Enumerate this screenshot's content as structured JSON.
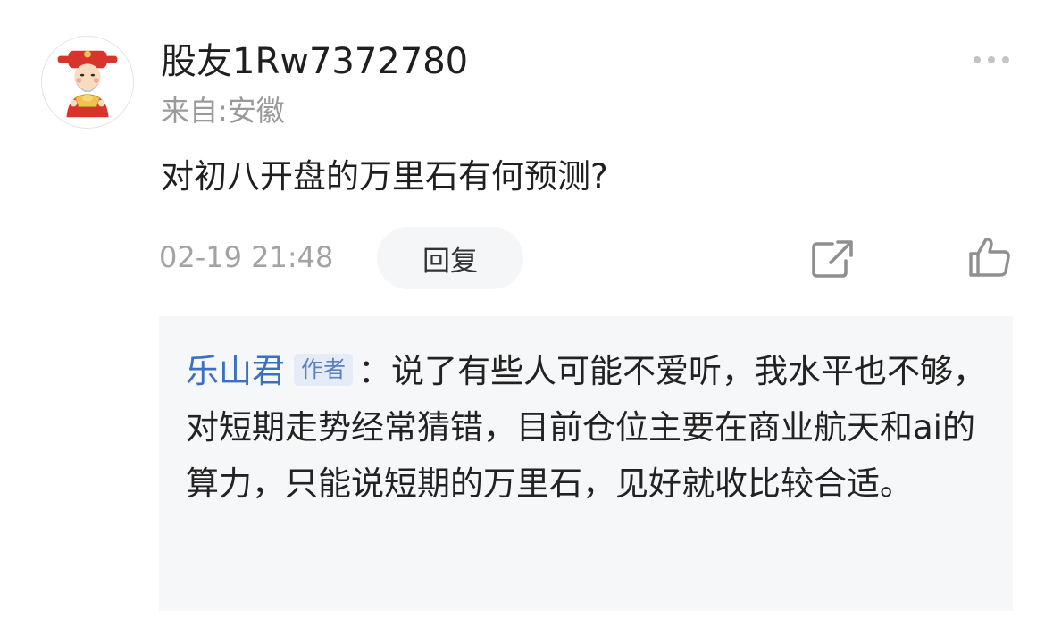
{
  "comment": {
    "username": "股友1Rw7372780",
    "location": "来自:安徽",
    "text": "对初八开盘的万里石有何预测?",
    "timestamp": "02-19 21:48",
    "reply_label": "回复"
  },
  "reply": {
    "author": "乐山君",
    "author_tag": "作者",
    "separator": "：",
    "text": "说了有些人可能不爱听，我水平也不够，对短期走势经常猜错，目前仓位主要在商业航天和ai的算力，只能说短期的万里石，见好就收比较合适。"
  },
  "icons": {
    "avatar": "caishen-avatar",
    "more": "more-dots-icon",
    "share": "share-icon",
    "like": "thumbs-up-icon"
  },
  "colors": {
    "author_link": "#3a6fc4",
    "muted_text": "#9a9a9a",
    "reply_bg": "#f6f7f9"
  }
}
